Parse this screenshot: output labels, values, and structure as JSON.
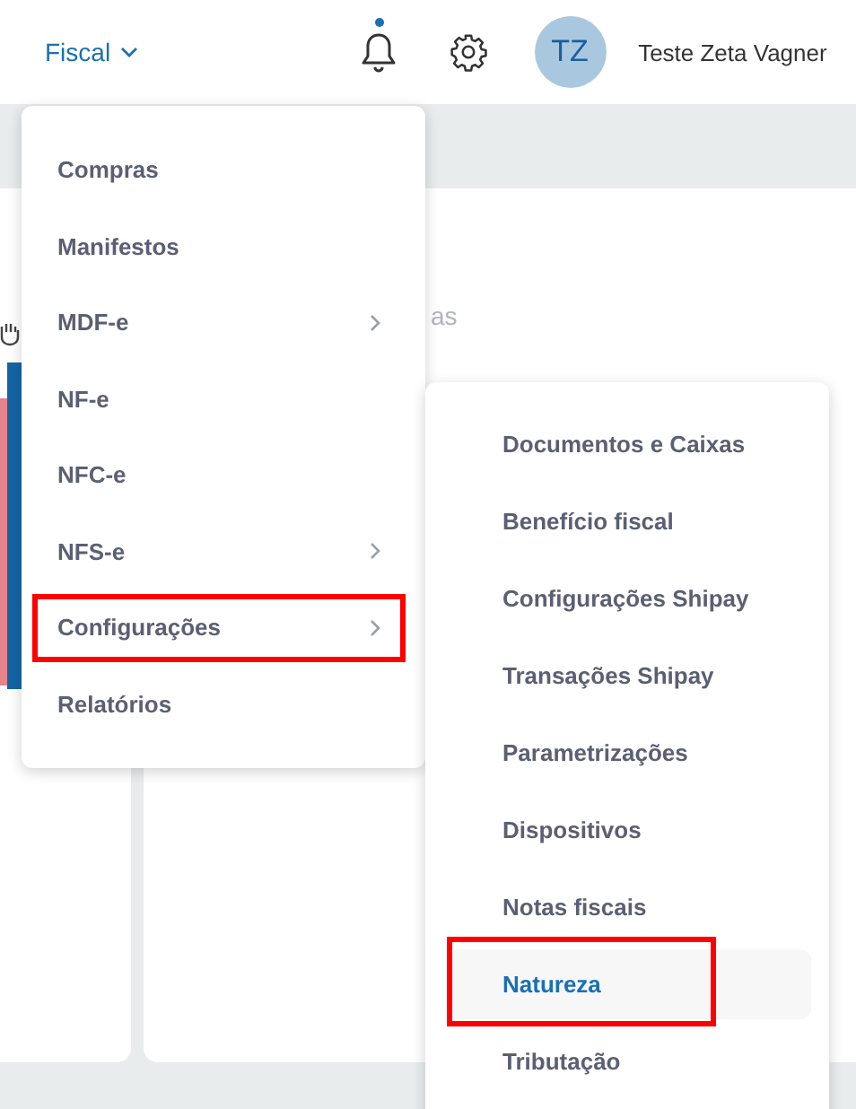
{
  "header": {
    "module_menu": {
      "label": "Fiscal",
      "expanded": true
    },
    "notifications": {
      "has_unread": true
    },
    "user": {
      "initials": "TZ",
      "name": "Teste Zeta Vagner"
    }
  },
  "page": {
    "card_text": "as"
  },
  "menu": {
    "items": [
      {
        "label": "Compras",
        "has_submenu": false,
        "annotated": false
      },
      {
        "label": "Manifestos",
        "has_submenu": false,
        "annotated": false
      },
      {
        "label": "MDF-e",
        "has_submenu": true,
        "annotated": false
      },
      {
        "label": "NF-e",
        "has_submenu": false,
        "annotated": false
      },
      {
        "label": "NFC-e",
        "has_submenu": false,
        "annotated": false
      },
      {
        "label": "NFS-e",
        "has_submenu": true,
        "annotated": false
      },
      {
        "label": "Configurações",
        "has_submenu": true,
        "annotated": true
      },
      {
        "label": "Relatórios",
        "has_submenu": false,
        "annotated": false
      }
    ]
  },
  "submenu": {
    "items": [
      {
        "label": "Documentos e Caixas",
        "selected": false,
        "annotated": false
      },
      {
        "label": "Benefício fiscal",
        "selected": false,
        "annotated": false
      },
      {
        "label": "Configurações Shipay",
        "selected": false,
        "annotated": false
      },
      {
        "label": "Transações Shipay",
        "selected": false,
        "annotated": false
      },
      {
        "label": "Parametrizações",
        "selected": false,
        "annotated": false
      },
      {
        "label": "Dispositivos",
        "selected": false,
        "annotated": false
      },
      {
        "label": "Notas fiscais",
        "selected": false,
        "annotated": false
      },
      {
        "label": "Natureza",
        "selected": true,
        "annotated": true
      },
      {
        "label": "Tributação",
        "selected": false,
        "annotated": false
      }
    ]
  }
}
